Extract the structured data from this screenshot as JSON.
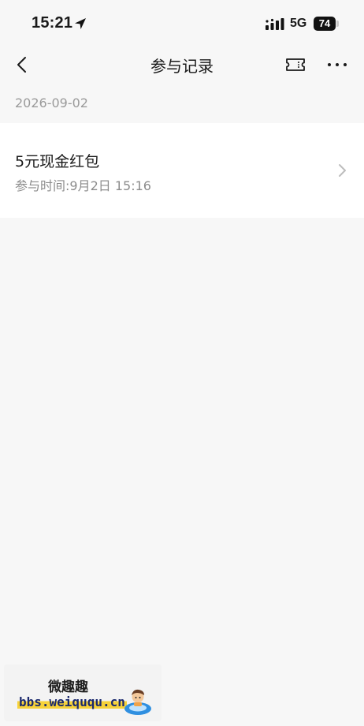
{
  "status_bar": {
    "time": "15:21",
    "network": "5G",
    "battery": "74"
  },
  "nav": {
    "title": "参与记录"
  },
  "records": {
    "date": "2026-09-02",
    "items": [
      {
        "title": "5元现金红包",
        "time": "参与时间:9月2日 15:16"
      }
    ]
  },
  "watermark": {
    "line1": "微趣趣",
    "line2": "bbs.weiququ.cn"
  },
  "icons": {
    "location": "location-arrow-icon",
    "signal": "signal-bars-icon",
    "back": "back-chevron-icon",
    "ticket": "ticket-icon",
    "more": "more-dots-icon",
    "chevron": "chevron-right-icon"
  }
}
